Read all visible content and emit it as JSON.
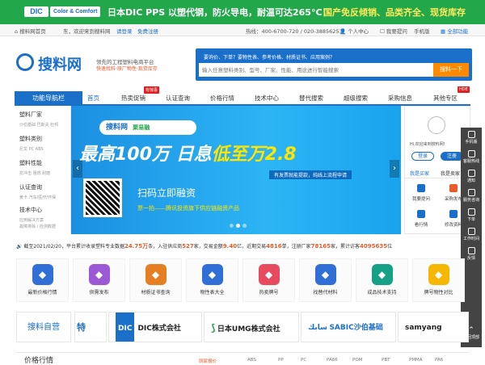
{
  "banner": {
    "dic_logo": "DIC",
    "color_comfort": "Color & Comfort",
    "headline": "日本DIC PPS  以塑代钢，防火导电，耐温可达265°C！",
    "headline_yellow": "国产免反倾销、品类齐全、现货库存",
    "bg_color": "#22a84a"
  },
  "topbar": {
    "home": "搜料网首页",
    "welcome": "东，欢迎来到搜料网",
    "login": "请登录",
    "register": "免费注册",
    "hotline": "热线：400-6700-720 / 020-38856253",
    "personal": "个人中心",
    "ask": "我要提问",
    "mobile": "手机版",
    "all_features": "全部功能"
  },
  "header": {
    "logo_text": "搜料网",
    "slogan": "领先的工程塑料电商平台",
    "slogan_sub": "快速找料·原厂物性·现货库存",
    "hot_search": "要询价、下单？要物性表、参考价格、材质证书、应用案例？",
    "search_placeholder": "输入任意塑料类别、型号、厂家、性能、用途进行智能搜索",
    "search_button": "搜料一下"
  },
  "nav": {
    "func_nav": "功能导航栏",
    "items": [
      "首页",
      "热卖促销",
      "认证查询",
      "价格行情",
      "技术中心",
      "替代搜索",
      "超级搜索",
      "采购信息",
      "其他专区"
    ],
    "badge_promo": "有惊喜",
    "badge_other": "HDE"
  },
  "sidebar": {
    "groups": [
      {
        "title": "塑料厂家",
        "sub": "沙伯基础  巴斯夫  杜邦"
      },
      {
        "title": "塑料类别",
        "sub": "尼龙    PC    ABS"
      },
      {
        "title": "塑料性能",
        "sub": "抗冲击  阻燃  耐磨"
      },
      {
        "title": "认证查询",
        "sub": "黄卡    汽车/医疗/环保"
      },
      {
        "title": "技术中心",
        "sub": "应用解决方案\n故障排除 / 检测数据"
      }
    ]
  },
  "carousel": {
    "brand": "搜料网",
    "brand2": "聚易融",
    "headline_a": "最高100万",
    "headline_b": "日息",
    "headline_c": "低至万",
    "headline_d": "2.8",
    "tag": "有发票就能提款，纯线上流程申请",
    "scan": "扫码立即融资",
    "scan_sub": "票一拍——腾讯投资旗下供应链融资产品",
    "slide_count": 3,
    "active_slide": 1
  },
  "user_panel": {
    "hi": "Hi,欢迎来到搜料网!",
    "login": "登录",
    "register": "注册",
    "tab_buyer": "我是买家",
    "tab_seller": "我是卖家",
    "cells": [
      "我要提问",
      "采购发布",
      "看行情",
      "修改资料"
    ]
  },
  "float_bar": [
    "手机版",
    "客服热线",
    "通知",
    "服务咨询",
    "下单",
    "工作时间",
    "反馈",
    "返回顶部"
  ],
  "ticker": {
    "prefix": "截至2021/02/20，平台累计收录塑料专业数据",
    "v1": "24.75万",
    "s1": "条，入驻供应商",
    "v2": "527",
    "s2": "家，交易金额",
    "v3": "9.40",
    "s3": "亿，近期交易",
    "v4": "4816",
    "s4": "单，注册厂家",
    "v5": "78165",
    "s5": "家，累计访客",
    "v6": "4095635",
    "s6": "位"
  },
  "icons": [
    {
      "label": "最新价格行情",
      "color": "#2f6fd6",
      "icon": "chart-icon"
    },
    {
      "label": "供需发布",
      "color": "#9b59d6",
      "icon": "send-icon"
    },
    {
      "label": "材质证书查询",
      "color": "#e67e22",
      "icon": "doc-icon"
    },
    {
      "label": "物性表大全",
      "color": "#2f6fd6",
      "icon": "book-icon"
    },
    {
      "label": "热卖牌号",
      "color": "#e84a5f",
      "icon": "fire-icon"
    },
    {
      "label": "找替代材料",
      "color": "#2f6fd6",
      "icon": "swap-icon"
    },
    {
      "label": "成品技术支持",
      "color": "#16a085",
      "icon": "tool-icon"
    },
    {
      "label": "牌号物性对比",
      "color": "#f5b700",
      "icon": "compare-icon"
    }
  ],
  "brands": {
    "self": "搜料自营",
    "items": [
      {
        "name": "特",
        "color": "#1a6fc9"
      },
      {
        "name": "DIC株式会社",
        "color": "#1a6fc9"
      },
      {
        "name": "日本UMG株式会社",
        "color": "#222"
      },
      {
        "name": "SABIC沙伯基础",
        "color": "#1a6fc9"
      },
      {
        "name": "samyang",
        "color": "#222"
      }
    ]
  },
  "price": {
    "title": "价格行情",
    "labels": [
      "厕家报价",
      "ABS",
      "PP",
      "PC",
      "PA66",
      "POM",
      "PBT",
      "PMMA",
      "PA6"
    ]
  }
}
